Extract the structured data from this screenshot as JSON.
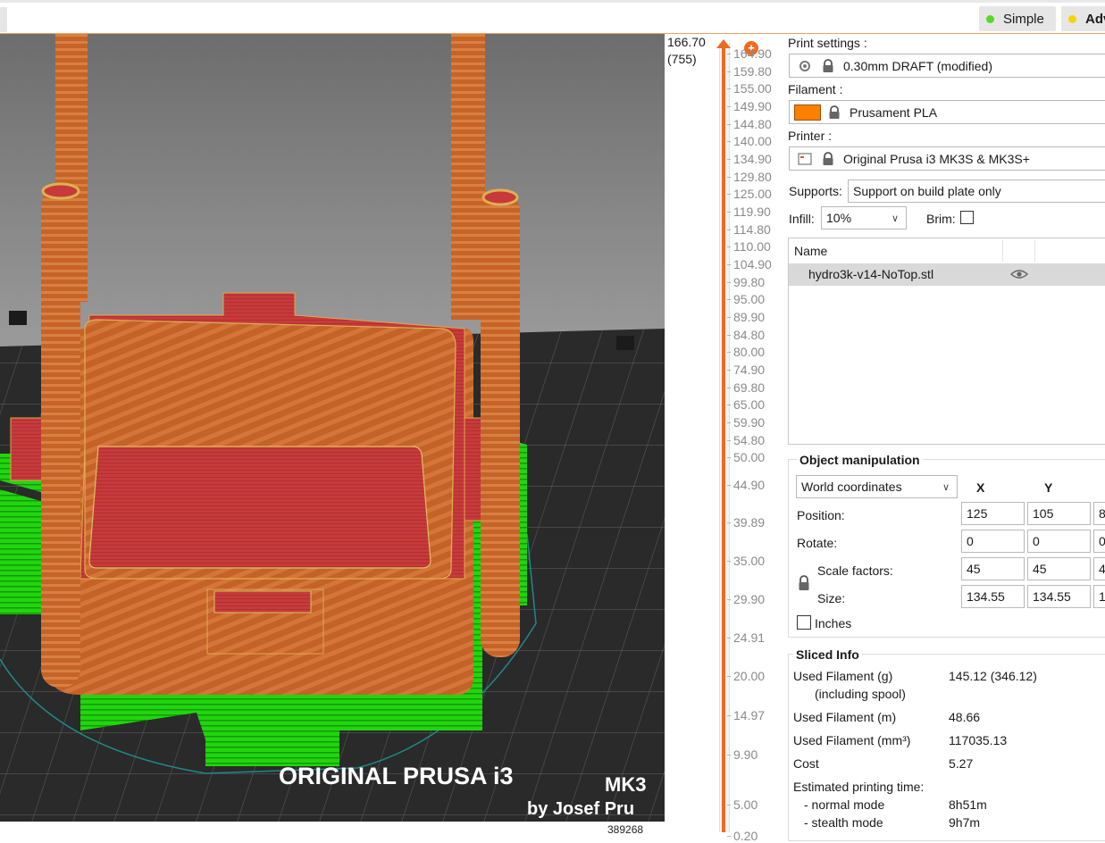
{
  "toolbar": {
    "simple_label": "Simple",
    "advanced_label": "Adv",
    "simple_dot_color": "#57d82a",
    "advanced_dot_color": "#f5d400"
  },
  "viewport": {
    "bed_text_line1": "ORIGINAL PRUSA i3",
    "bed_text_model": "MK3",
    "bed_text_line2": "by Josef Pru",
    "bottom_number": "389268",
    "colors": {
      "perimeter": "#c9662a",
      "top_solid": "#c1373a",
      "support": "#1fd10f",
      "bed": "#2b2b2b"
    }
  },
  "layer_slider": {
    "top_height": "166.70",
    "top_layer": "(755)",
    "ticks": [
      "164.90",
      "159.80",
      "155.00",
      "149.90",
      "144.80",
      "140.00",
      "134.90",
      "129.80",
      "125.00",
      "119.90",
      "114.80",
      "110.00",
      "104.90",
      "99.80",
      "95.00",
      "89.90",
      "84.80",
      "80.00",
      "74.90",
      "69.80",
      "65.00",
      "59.90",
      "54.80",
      "50.00",
      "44.90",
      "39.89",
      "35.00",
      "29.90",
      "24.91",
      "20.00",
      "14.97",
      "9.90",
      "5.00",
      "0.20"
    ],
    "accent_color": "#ed6b21"
  },
  "panel": {
    "print_settings_label": "Print settings :",
    "print_settings_value": "0.30mm DRAFT (modified)",
    "filament_label": "Filament :",
    "filament_value": "Prusament PLA",
    "filament_color": "#ff7f00",
    "printer_label": "Printer :",
    "printer_value": "Original Prusa i3 MK3S & MK3S+",
    "supports_label": "Supports:",
    "supports_value": "Support on build plate only",
    "infill_label": "Infill:",
    "infill_value": "10%",
    "brim_label": "Brim:",
    "object_list": {
      "header_name": "Name",
      "items": [
        {
          "name": "hydro3k-v14-NoTop.stl"
        }
      ]
    },
    "object_manipulation": {
      "title": "Object manipulation",
      "coord_system": "World coordinates",
      "col_x": "X",
      "col_y": "Y",
      "rows": [
        {
          "label": "Position:",
          "x": "125",
          "y": "105",
          "z": "8"
        },
        {
          "label": "Rotate:",
          "x": "0",
          "y": "0",
          "z": "0"
        },
        {
          "label": "Scale factors:",
          "x": "45",
          "y": "45",
          "z": "4"
        },
        {
          "label": "Size:",
          "x": "134.55",
          "y": "134.55",
          "z": "1"
        }
      ],
      "inches_label": "Inches"
    },
    "sliced_info": {
      "title": "Sliced Info",
      "used_filament_g_label": "Used Filament (g)",
      "used_filament_g_sub": "(including spool)",
      "used_filament_g_value": "145.12 (346.12)",
      "used_filament_m_label": "Used Filament (m)",
      "used_filament_m_value": "48.66",
      "used_filament_mm3_label": "Used Filament (mm³)",
      "used_filament_mm3_value": "117035.13",
      "cost_label": "Cost",
      "cost_value": "5.27",
      "est_time_label": "Estimated printing time:",
      "normal_mode_label": "- normal mode",
      "normal_mode_value": "8h51m",
      "stealth_mode_label": "- stealth mode",
      "stealth_mode_value": "9h7m"
    }
  }
}
